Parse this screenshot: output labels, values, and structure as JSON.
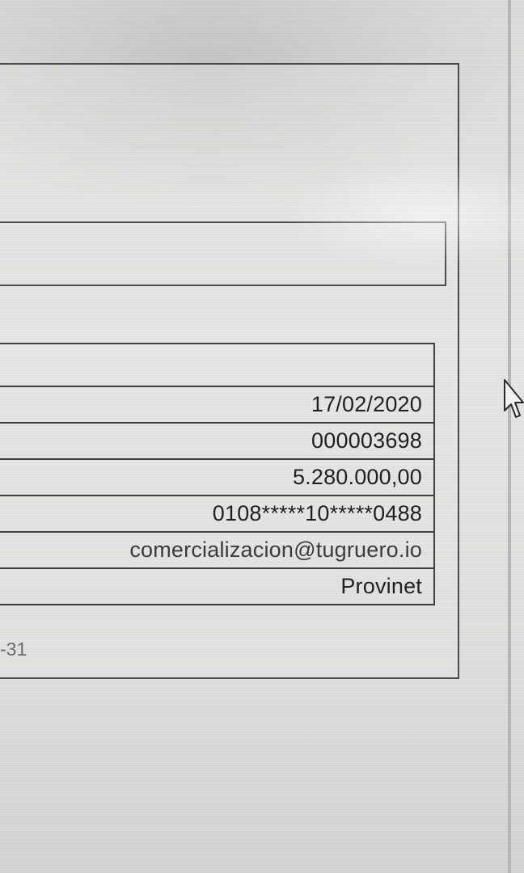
{
  "transaction_table": {
    "rows": [
      {
        "value": "17/02/2020"
      },
      {
        "value": "000003698"
      },
      {
        "value": "5.280.000,00"
      },
      {
        "value": "0108*****10*****0488"
      },
      {
        "value": "comercializacion@tugruero.io"
      },
      {
        "value": "Provinet"
      }
    ]
  },
  "footer_fragment": "-31",
  "colors": {
    "text": "#1e2122",
    "border": "#3e4041",
    "background": "#e2e4e3"
  }
}
